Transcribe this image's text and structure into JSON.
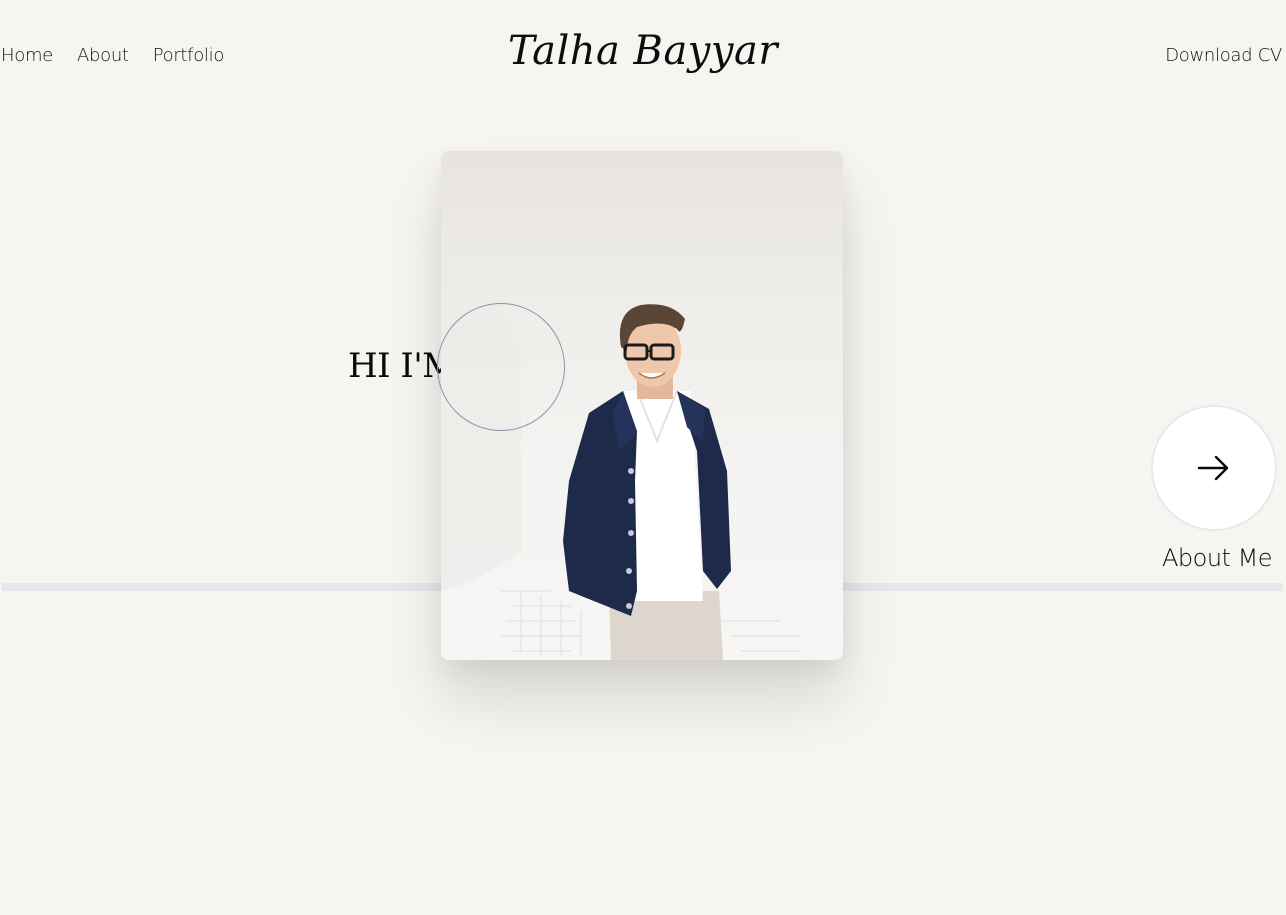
{
  "nav": {
    "links": [
      {
        "label": "Home"
      },
      {
        "label": "About"
      },
      {
        "label": "Portfolio"
      }
    ],
    "brand": "Talha Bayyar",
    "cv_label": "Download CV"
  },
  "hero": {
    "text": "HI I'MTA",
    "cta_label": "About Me",
    "cta_icon": "arrow-right-icon"
  },
  "colors": {
    "background": "#f6f5f1",
    "divider": "#e6e7ea",
    "circle_stroke": "#8a93a6",
    "jacket": "#1d2a4a"
  }
}
